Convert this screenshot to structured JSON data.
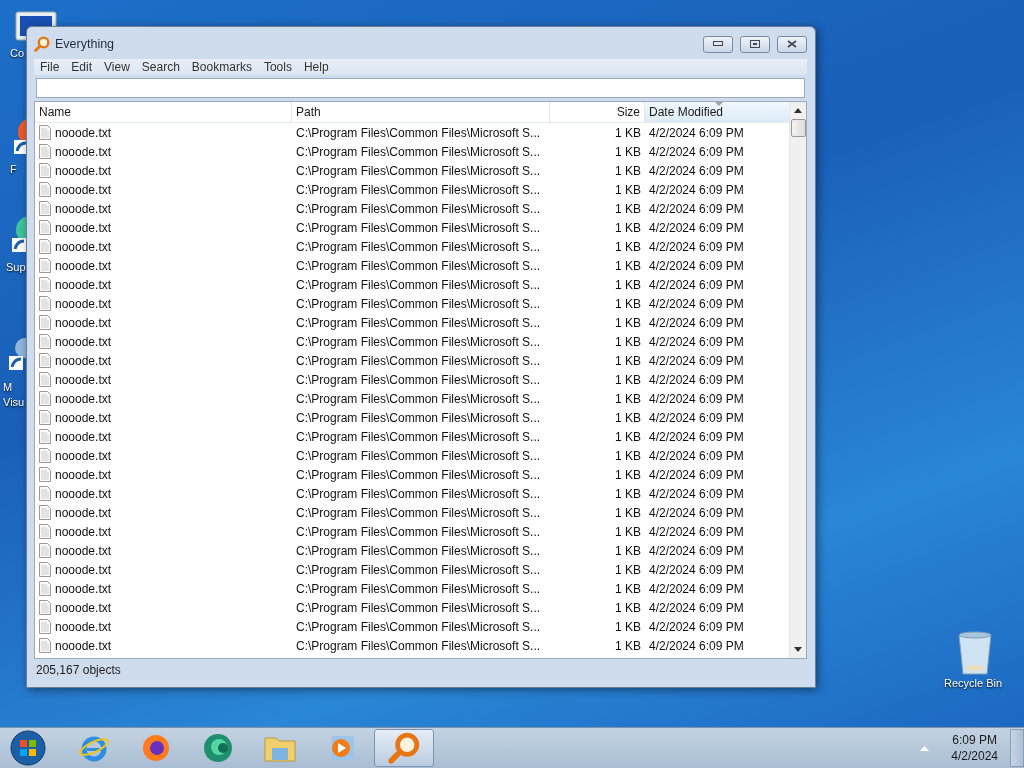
{
  "desktop": {
    "icons": [
      {
        "label": "Co",
        "kind": "computer"
      },
      {
        "label": "F",
        "kind": "firefox"
      },
      {
        "label": "Sup",
        "kind": "app"
      },
      {
        "label": "M",
        "label_2": "Visu",
        "kind": "studio"
      },
      {
        "label": "Recycle Bin",
        "kind": "bin"
      }
    ]
  },
  "window": {
    "title": "Everything",
    "menu": [
      "File",
      "Edit",
      "View",
      "Search",
      "Bookmarks",
      "Tools",
      "Help"
    ],
    "columns": [
      {
        "label": "Name",
        "sorted": false
      },
      {
        "label": "Path",
        "sorted": false
      },
      {
        "label": "Size",
        "sorted": false
      },
      {
        "label": "Date Modified",
        "sorted": true
      }
    ],
    "rows": [
      {
        "name": "nooode.txt",
        "path": "C:\\Program Files\\Common Files\\Microsoft S...",
        "size": "1 KB",
        "date": "4/2/2024 6:09 PM"
      },
      {
        "name": "nooode.txt",
        "path": "C:\\Program Files\\Common Files\\Microsoft S...",
        "size": "1 KB",
        "date": "4/2/2024 6:09 PM"
      },
      {
        "name": "nooode.txt",
        "path": "C:\\Program Files\\Common Files\\Microsoft S...",
        "size": "1 KB",
        "date": "4/2/2024 6:09 PM"
      },
      {
        "name": "nooode.txt",
        "path": "C:\\Program Files\\Common Files\\Microsoft S...",
        "size": "1 KB",
        "date": "4/2/2024 6:09 PM"
      },
      {
        "name": "nooode.txt",
        "path": "C:\\Program Files\\Common Files\\Microsoft S...",
        "size": "1 KB",
        "date": "4/2/2024 6:09 PM"
      },
      {
        "name": "nooode.txt",
        "path": "C:\\Program Files\\Common Files\\Microsoft S...",
        "size": "1 KB",
        "date": "4/2/2024 6:09 PM"
      },
      {
        "name": "nooode.txt",
        "path": "C:\\Program Files\\Common Files\\Microsoft S...",
        "size": "1 KB",
        "date": "4/2/2024 6:09 PM"
      },
      {
        "name": "nooode.txt",
        "path": "C:\\Program Files\\Common Files\\Microsoft S...",
        "size": "1 KB",
        "date": "4/2/2024 6:09 PM"
      },
      {
        "name": "nooode.txt",
        "path": "C:\\Program Files\\Common Files\\Microsoft S...",
        "size": "1 KB",
        "date": "4/2/2024 6:09 PM"
      },
      {
        "name": "nooode.txt",
        "path": "C:\\Program Files\\Common Files\\Microsoft S...",
        "size": "1 KB",
        "date": "4/2/2024 6:09 PM"
      },
      {
        "name": "nooode.txt",
        "path": "C:\\Program Files\\Common Files\\Microsoft S...",
        "size": "1 KB",
        "date": "4/2/2024 6:09 PM"
      },
      {
        "name": "nooode.txt",
        "path": "C:\\Program Files\\Common Files\\Microsoft S...",
        "size": "1 KB",
        "date": "4/2/2024 6:09 PM"
      },
      {
        "name": "nooode.txt",
        "path": "C:\\Program Files\\Common Files\\Microsoft S...",
        "size": "1 KB",
        "date": "4/2/2024 6:09 PM"
      },
      {
        "name": "nooode.txt",
        "path": "C:\\Program Files\\Common Files\\Microsoft S...",
        "size": "1 KB",
        "date": "4/2/2024 6:09 PM"
      },
      {
        "name": "nooode.txt",
        "path": "C:\\Program Files\\Common Files\\Microsoft S...",
        "size": "1 KB",
        "date": "4/2/2024 6:09 PM"
      },
      {
        "name": "nooode.txt",
        "path": "C:\\Program Files\\Common Files\\Microsoft S...",
        "size": "1 KB",
        "date": "4/2/2024 6:09 PM"
      },
      {
        "name": "nooode.txt",
        "path": "C:\\Program Files\\Common Files\\Microsoft S...",
        "size": "1 KB",
        "date": "4/2/2024 6:09 PM"
      },
      {
        "name": "nooode.txt",
        "path": "C:\\Program Files\\Common Files\\Microsoft S...",
        "size": "1 KB",
        "date": "4/2/2024 6:09 PM"
      },
      {
        "name": "nooode.txt",
        "path": "C:\\Program Files\\Common Files\\Microsoft S...",
        "size": "1 KB",
        "date": "4/2/2024 6:09 PM"
      },
      {
        "name": "nooode.txt",
        "path": "C:\\Program Files\\Common Files\\Microsoft S...",
        "size": "1 KB",
        "date": "4/2/2024 6:09 PM"
      },
      {
        "name": "nooode.txt",
        "path": "C:\\Program Files\\Common Files\\Microsoft S...",
        "size": "1 KB",
        "date": "4/2/2024 6:09 PM"
      },
      {
        "name": "nooode.txt",
        "path": "C:\\Program Files\\Common Files\\Microsoft S...",
        "size": "1 KB",
        "date": "4/2/2024 6:09 PM"
      },
      {
        "name": "nooode.txt",
        "path": "C:\\Program Files\\Common Files\\Microsoft S...",
        "size": "1 KB",
        "date": "4/2/2024 6:09 PM"
      },
      {
        "name": "nooode.txt",
        "path": "C:\\Program Files\\Common Files\\Microsoft S...",
        "size": "1 KB",
        "date": "4/2/2024 6:09 PM"
      },
      {
        "name": "nooode.txt",
        "path": "C:\\Program Files\\Common Files\\Microsoft S...",
        "size": "1 KB",
        "date": "4/2/2024 6:09 PM"
      },
      {
        "name": "nooode.txt",
        "path": "C:\\Program Files\\Common Files\\Microsoft S...",
        "size": "1 KB",
        "date": "4/2/2024 6:09 PM"
      },
      {
        "name": "nooode.txt",
        "path": "C:\\Program Files\\Common Files\\Microsoft S...",
        "size": "1 KB",
        "date": "4/2/2024 6:09 PM"
      },
      {
        "name": "nooode.txt",
        "path": "C:\\Program Files\\Common Files\\Microsoft S...",
        "size": "1 KB",
        "date": "4/2/2024 6:09 PM"
      }
    ],
    "status_bar": "205,167 objects"
  },
  "taskbar": {
    "apps": [
      {
        "kind": "ie",
        "selected": false
      },
      {
        "kind": "firefox",
        "selected": false
      },
      {
        "kind": "edge",
        "selected": false
      },
      {
        "kind": "explorer",
        "selected": false
      },
      {
        "kind": "media",
        "selected": false
      },
      {
        "kind": "everything",
        "selected": true
      }
    ],
    "time": "6:09 PM",
    "date": "4/2/2024"
  }
}
